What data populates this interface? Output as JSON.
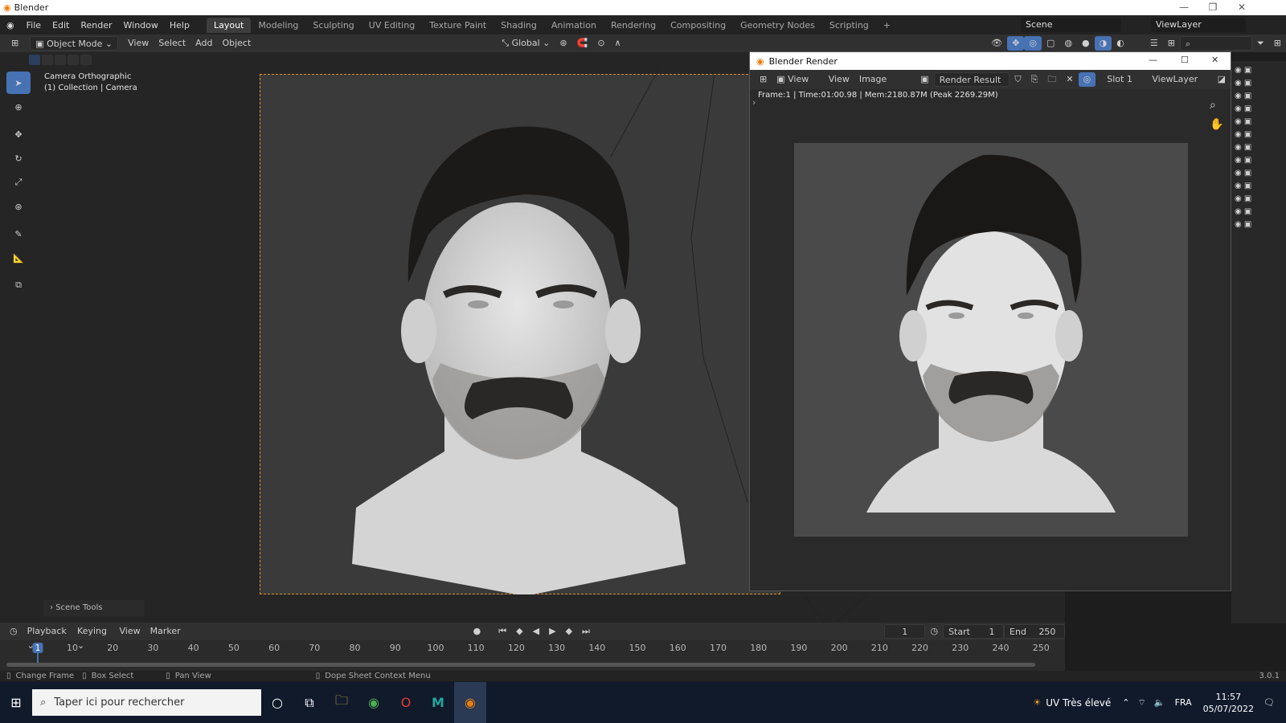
{
  "window": {
    "title": "Blender"
  },
  "menus": [
    "File",
    "Edit",
    "Render",
    "Window",
    "Help"
  ],
  "workspaces": [
    "Layout",
    "Modeling",
    "Sculpting",
    "UV Editing",
    "Texture Paint",
    "Shading",
    "Animation",
    "Rendering",
    "Compositing",
    "Geometry Nodes",
    "Scripting"
  ],
  "active_workspace": "Layout",
  "scene": {
    "name": "Scene",
    "view_layer": "ViewLayer"
  },
  "viewport_header": {
    "mode": "Object Mode",
    "menus": [
      "View",
      "Select",
      "Add",
      "Object"
    ],
    "transform_orientation": "Global"
  },
  "viewport": {
    "camera_label": "Camera Orthographic",
    "collection_label": "(1) Collection | Camera",
    "scene_tools": "Scene Tools"
  },
  "render_window": {
    "title": "Blender Render",
    "menus": [
      "View",
      "View",
      "Image"
    ],
    "image_name": "Render Result",
    "slot": "Slot 1",
    "view_layer": "ViewLayer",
    "info": "Frame:1 | Time:01:00.98 | Mem:2180.87M (Peak 2269.29M)"
  },
  "timeline": {
    "menus": [
      "Playback",
      "Keying",
      "View",
      "Marker"
    ],
    "current_frame": "1",
    "start_label": "Start",
    "start_value": "1",
    "end_label": "End",
    "end_value": "250",
    "ticks": [
      "1",
      "10",
      "20",
      "30",
      "40",
      "50",
      "60",
      "70",
      "80",
      "90",
      "100",
      "110",
      "120",
      "130",
      "140",
      "150",
      "160",
      "170",
      "180",
      "190",
      "200",
      "210",
      "220",
      "230",
      "240",
      "250"
    ]
  },
  "statusbar": {
    "items": [
      "Change Frame",
      "Box Select",
      "Pan View",
      "Dope Sheet Context Menu"
    ],
    "version": "3.0.1"
  },
  "taskbar": {
    "search_placeholder": "Taper ici pour rechercher",
    "weather": "UV Très élevé",
    "language": "FRA",
    "time": "11:57",
    "date": "05/07/2022"
  },
  "colors": {
    "accent": "#4772b3",
    "camera_frame": "#d8902c",
    "panel_bg": "#303030",
    "viewport_bg": "#3a3a3a"
  }
}
